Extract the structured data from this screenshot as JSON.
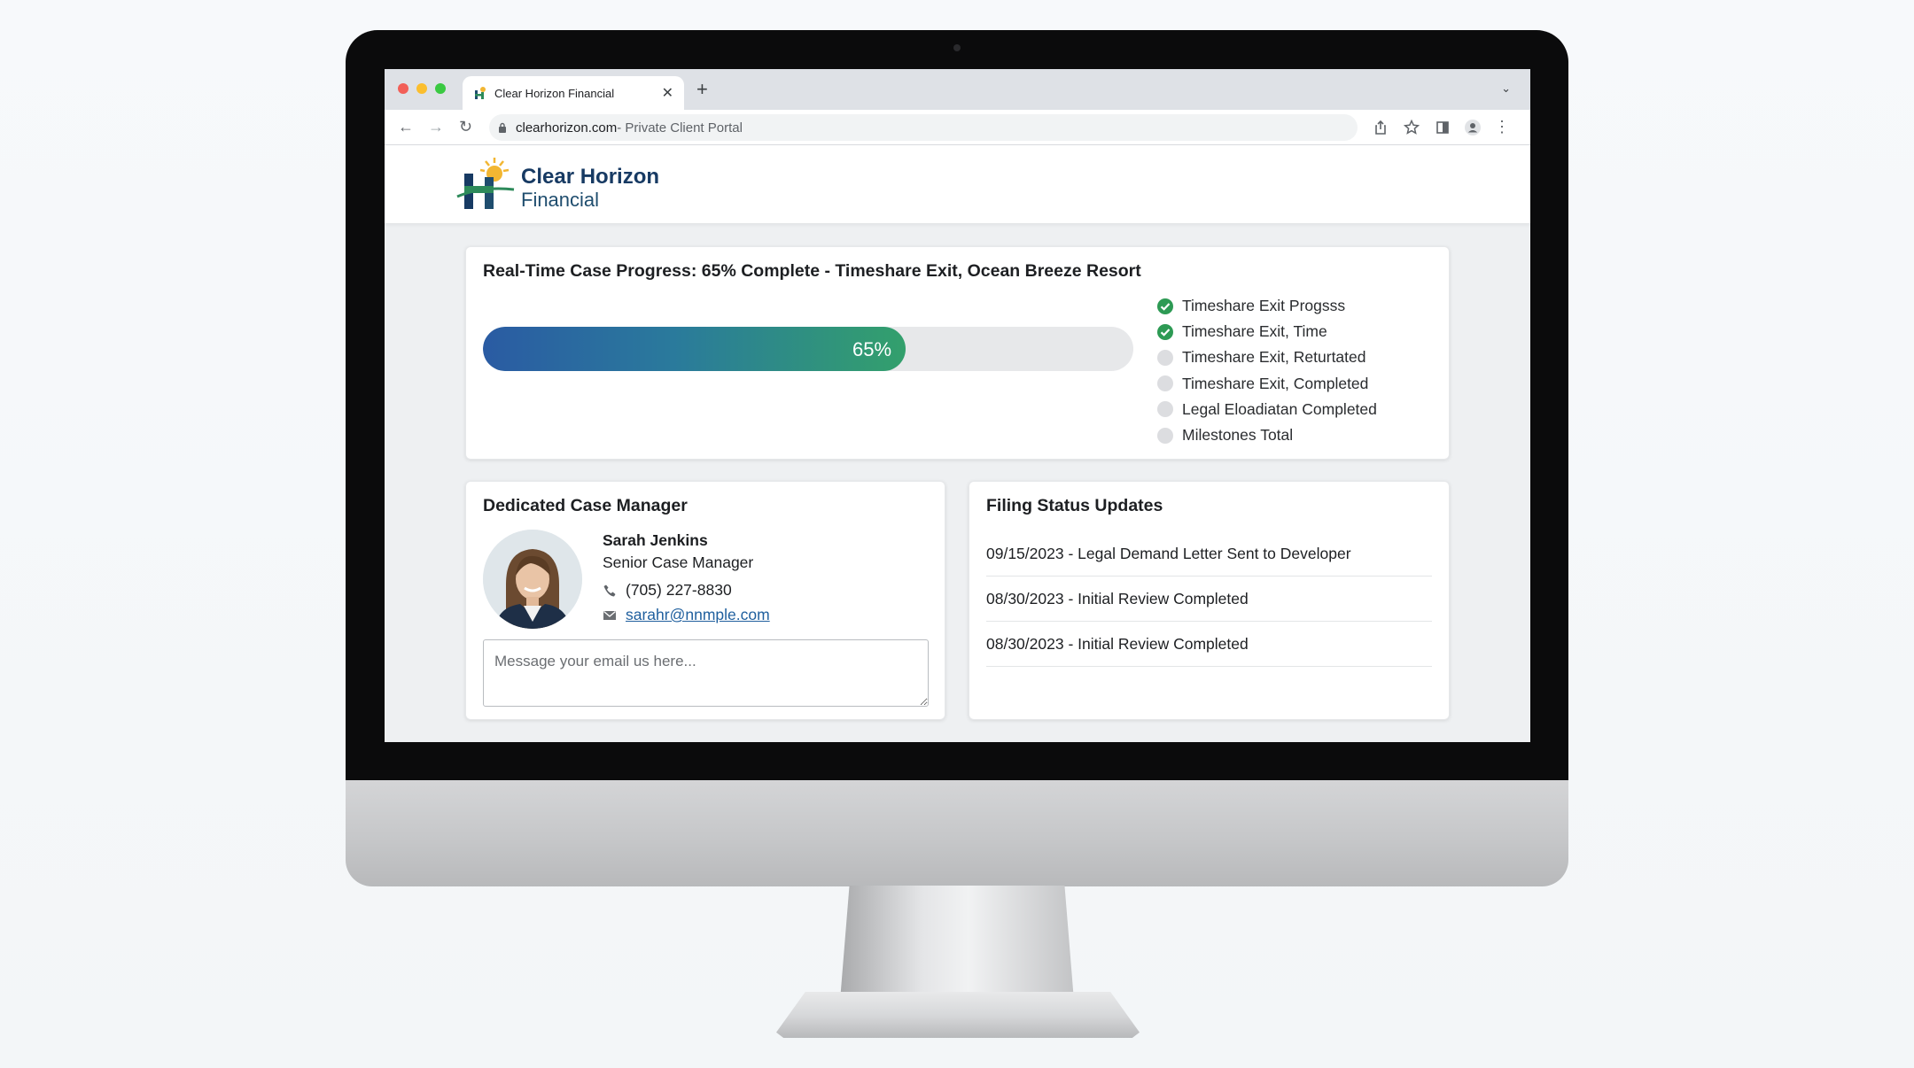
{
  "browser": {
    "tab_title": "Clear Horizon Financial",
    "new_tab_symbol": "+",
    "url_host": "clearhorizon.com",
    "url_rest": " - Private Client Portal"
  },
  "site": {
    "logo_line1": "Clear Horizon",
    "logo_line2": "Financial"
  },
  "progress": {
    "title": "Real-Time Case Progress: 65% Complete - Timeshare Exit, Ocean Breeze Resort",
    "percent": 65,
    "percent_label": "65%",
    "bar_colors": [
      "#2a5ba3",
      "#33a06c"
    ],
    "milestones": [
      {
        "label": "Timeshare Exit Progsss",
        "done": true
      },
      {
        "label": "Timeshare Exit, Time",
        "done": true
      },
      {
        "label": "Timeshare Exit, Returtated",
        "done": false
      },
      {
        "label": "Timeshare Exit, Completed",
        "done": false
      },
      {
        "label": "Legal Eloadiatan Completed",
        "done": false
      },
      {
        "label": "Milestones Total",
        "done": false
      }
    ]
  },
  "manager": {
    "title": "Dedicated Case Manager",
    "name": "Sarah Jenkins",
    "role": "Senior Case Manager",
    "phone": "(705) 227-8830",
    "email": "sarahr@nnmple.com",
    "message_placeholder": "Message your email us here..."
  },
  "updates": {
    "title": "Filing Status Updates",
    "items": [
      "09/15/2023 - Legal Demand Letter Sent to Developer",
      "08/30/2023 - Initial Review Completed",
      "08/30/2023 - Initial Review Completed"
    ]
  },
  "colors": {
    "brand_navy": "#173a63",
    "success_green": "#2d9a54",
    "link_blue": "#1f5f9e"
  }
}
